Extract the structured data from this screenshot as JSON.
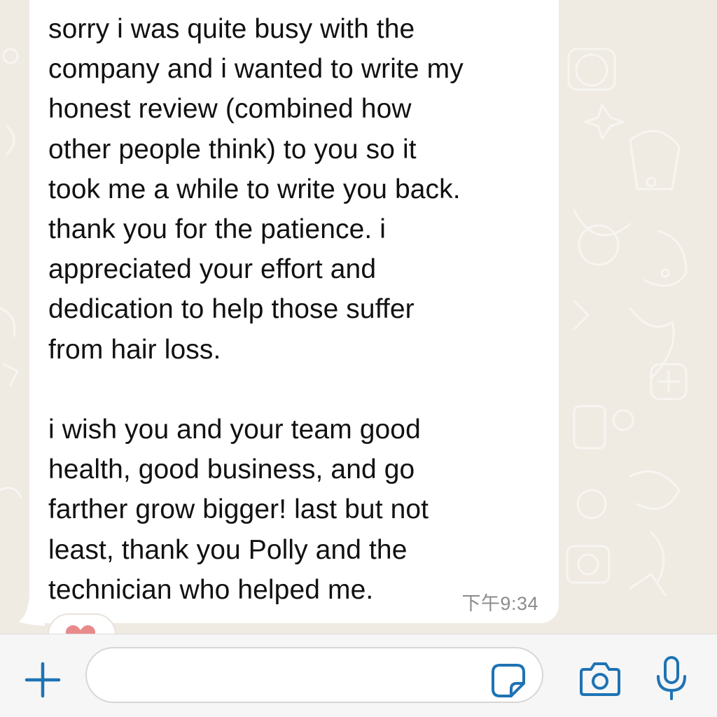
{
  "chat": {
    "message": {
      "text": "sorry i was quite busy with the\ncompany and i wanted to write my\nhonest review (combined how\nother people think) to you so it\ntook me a while to write you back.\nthank you for the patience. i\nappreciated your effort and\ndedication to help those suffer\nfrom hair loss.\n\ni wish you and your team good\nhealth, good business, and go\nfarther grow bigger! last but not\nleast, thank you Polly and the\ntechnician who helped me.",
      "time": "下午9:34",
      "reaction": "heart"
    }
  },
  "input_bar": {
    "message_value": "",
    "icons": {
      "attach": "plus-icon",
      "sticker": "sticker-icon",
      "camera": "camera-icon",
      "voice": "microphone-icon"
    }
  },
  "colors": {
    "background": "#efeae2",
    "bubble": "#ffffff",
    "accent": "#1e73b4",
    "timestamp": "#8c8c8c",
    "reaction_heart": "#e98a8a"
  }
}
